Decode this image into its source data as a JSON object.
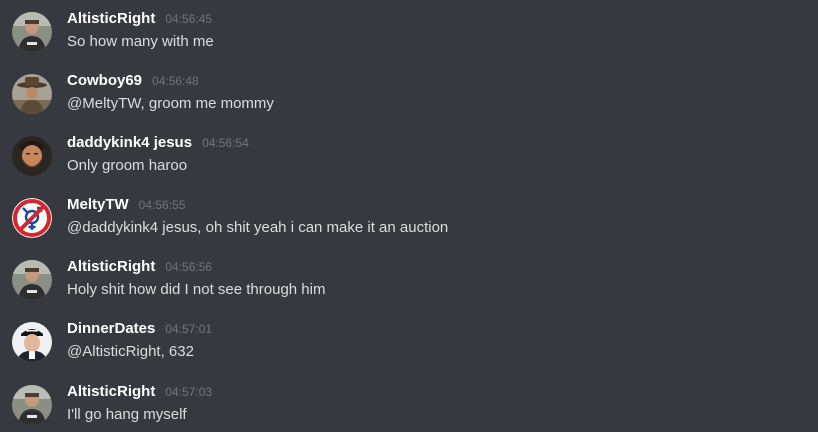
{
  "messages": [
    {
      "username": "AltisticRight",
      "timestamp": "04:56:45",
      "text": "So how many with me",
      "avatar": "man-outdoor-avatar"
    },
    {
      "username": "Cowboy69",
      "timestamp": "04:56:48",
      "text": "@MeltyTW, groom me mommy",
      "avatar": "cowboy-avatar"
    },
    {
      "username": "daddykink4 jesus",
      "timestamp": "04:56:54",
      "text": "Only groom haroo",
      "avatar": "bearded-man-avatar"
    },
    {
      "username": "MeltyTW",
      "timestamp": "04:56:55",
      "text": "@daddykink4 jesus, oh shit yeah i can make it an auction",
      "avatar": "prohibited-symbol-avatar"
    },
    {
      "username": "AltisticRight",
      "timestamp": "04:56:56",
      "text": "Holy shit how did I not see through him",
      "avatar": "man-outdoor-avatar"
    },
    {
      "username": "DinnerDates",
      "timestamp": "04:57:01",
      "text": "@AltisticRight, 632",
      "avatar": "man-in-cap-avatar"
    },
    {
      "username": "AltisticRight",
      "timestamp": "04:57:03",
      "text": "I'll go hang myself",
      "avatar": "man-outdoor-avatar"
    }
  ],
  "colors": {
    "background": "#36393f",
    "username": "#ffffff",
    "timestamp": "#72767d",
    "text": "#dcddde",
    "prohibited_red": "#d6262c"
  }
}
